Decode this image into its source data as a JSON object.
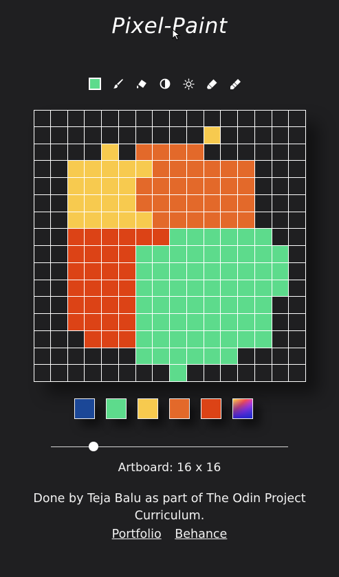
{
  "app": {
    "title": "Pixel-Paint"
  },
  "toolbar": {
    "current_color": "#5ddb8c",
    "tools": [
      {
        "name": "current-color-swatch"
      },
      {
        "name": "brush-icon"
      },
      {
        "name": "fill-icon"
      },
      {
        "name": "contrast-icon"
      },
      {
        "name": "brightness-icon"
      },
      {
        "name": "eraser-icon"
      },
      {
        "name": "clear-icon"
      }
    ]
  },
  "artboard": {
    "size_label": "Artboard: 16 x 16",
    "grid_size": 16,
    "empty_color": "#1f1f21",
    "colors": {
      "B": "#1b4797",
      "G": "#5ddb8c",
      "Y": "#f7ca4f",
      "O": "#e3692a",
      "R": "#dc4316"
    },
    "rows": [
      "................",
      "..........Y.....",
      "....Y.OOOO......",
      "..YYYYYOOOOOO...",
      "..YYYYOOOOOOO...",
      "..YYYYOOOOOOO...",
      "..YYYYYOOOOOO...",
      "..RRRRRRGGGGGG..",
      "..RRRRGGGGGGGGG.",
      "..RRRRGGGGGGGGG.",
      "..RRRRGGGGGGGGG.",
      "..RRRRGGGGGGGG..",
      "..RRRRGGGGGGGG..",
      "...RRRGGGGGGGG..",
      "......GGGGGG....",
      "........G......."
    ]
  },
  "palette": {
    "swatches": [
      {
        "name": "palette-blue",
        "color": "#1b4797"
      },
      {
        "name": "palette-green",
        "color": "#5ddb8c"
      },
      {
        "name": "palette-yellow",
        "color": "#f7ca4f"
      },
      {
        "name": "palette-orange",
        "color": "#e3692a"
      },
      {
        "name": "palette-red",
        "color": "#dc4316"
      }
    ],
    "picker_name": "palette-color-picker"
  },
  "slider": {
    "value_fraction": 0.18
  },
  "footer": {
    "credit": "Done by Teja Balu as part of The Odin Project Curriculum.",
    "portfolio_label": "Portfolio",
    "behance_label": "Behance"
  }
}
